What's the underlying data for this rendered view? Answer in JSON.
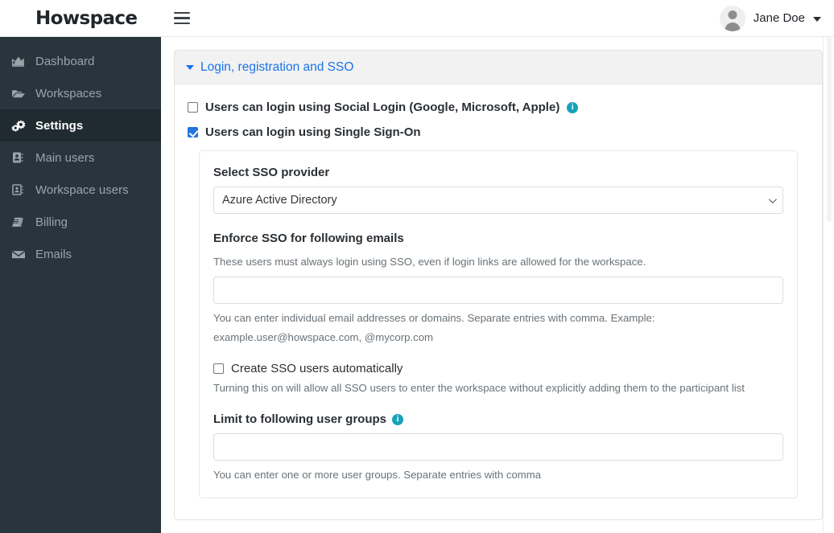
{
  "topbar": {
    "brand": "Howspace",
    "menu_icon": "hamburger-icon",
    "user_name": "Jane Doe",
    "avatar_icon": "user-avatar-icon",
    "caret_icon": "caret-down-icon"
  },
  "sidebar": {
    "items": [
      {
        "label": "Dashboard",
        "icon": "area-chart-icon",
        "active": false
      },
      {
        "label": "Workspaces",
        "icon": "folder-open-icon",
        "active": false
      },
      {
        "label": "Settings",
        "icon": "gears-icon",
        "active": true
      },
      {
        "label": "Main users",
        "icon": "address-book-icon",
        "active": false
      },
      {
        "label": "Workspace users",
        "icon": "address-card-icon",
        "active": false
      },
      {
        "label": "Billing",
        "icon": "book-icon",
        "active": false
      },
      {
        "label": "Emails",
        "icon": "envelope-icon",
        "active": false
      }
    ]
  },
  "panel": {
    "title": "Login, registration and SSO",
    "collapse_icon": "triangle-down-icon",
    "expanded": true
  },
  "options": {
    "social_login": {
      "label": "Users can login using Social Login (Google, Microsoft, Apple)",
      "checked": false,
      "info_icon": "info-circle-icon",
      "info_glyph": "i"
    },
    "single_sign_on": {
      "label": "Users can login using Single Sign-On",
      "checked": true
    }
  },
  "sso_card": {
    "provider": {
      "label": "Select SSO provider",
      "selected": "Azure Active Directory",
      "chevron_icon": "chevron-down-icon"
    },
    "enforce_emails": {
      "label": "Enforce SSO for following emails",
      "description": "These users must always login using SSO, even if login links are allowed for the workspace.",
      "value": "",
      "placeholder": "",
      "help_line_1": "You can enter individual email addresses or domains. Separate entries with comma. Example:",
      "help_line_2": "example.user@howspace.com, @mycorp.com"
    },
    "create_users": {
      "label": "Create SSO users automatically",
      "checked": false,
      "description": "Turning this on will allow all SSO users to enter the workspace without explicitly adding them to the participant list"
    },
    "user_groups": {
      "label": "Limit to following user groups",
      "info_icon": "info-circle-icon",
      "info_glyph": "i",
      "value": "",
      "placeholder": "",
      "help": "You can enter one or more user groups. Separate entries with comma"
    }
  },
  "colors": {
    "sidebar_bg": "#28353d",
    "sidebar_active_bg": "#1f2a31",
    "link_blue": "#1a73e8",
    "checkbox_blue": "#2374e1",
    "info_teal": "#17a2b8",
    "panel_header_bg": "#f2f2f2"
  }
}
